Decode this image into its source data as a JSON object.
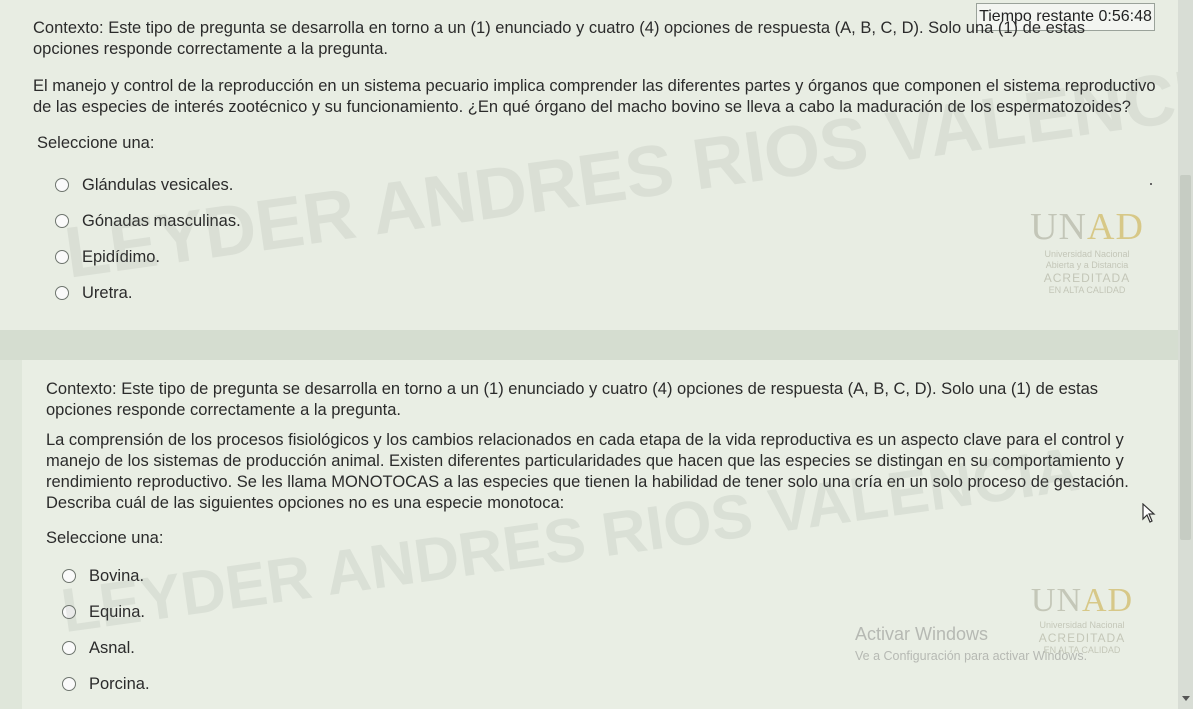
{
  "timer": {
    "label": "Tiempo restante",
    "value": "0:56:48"
  },
  "question1": {
    "context": "Contexto: Este tipo de pregunta se desarrolla en torno a un (1) enunciado y cuatro (4) opciones de respuesta (A, B, C, D). Solo una (1) de estas opciones responde correctamente a la pregunta.",
    "stem": "El manejo y control de la reproducción en un sistema pecuario implica comprender las diferentes partes y órganos que componen el sistema reproductivo de las especies de interés zootécnico y su funcionamiento. ¿En qué órgano del macho bovino se lleva a cabo la maduración de los espermatozoides?",
    "prompt": "Seleccione una:",
    "options": [
      "Glándulas vesicales.",
      "Gónadas masculinas.",
      "Epidídimo.",
      "Uretra."
    ]
  },
  "question2": {
    "context": "Contexto: Este tipo de pregunta se desarrolla en torno a un (1) enunciado y cuatro (4) opciones de respuesta (A, B, C, D). Solo una (1) de estas opciones responde correctamente a la pregunta.",
    "stem": "La comprensión de los procesos fisiológicos y los cambios relacionados en cada etapa de la vida reproductiva es un aspecto clave para el control y manejo de los sistemas de producción animal. Existen diferentes particularidades que hacen que las especies se distingan en su comportamiento y rendimiento reproductivo. Se les llama MONOTOCAS a las especies que tienen la habilidad de tener solo una cría en un solo proceso de gestación. Describa cuál de las siguientes opciones no es una especie monotoca:",
    "prompt": "Seleccione una:",
    "options": [
      "Bovina.",
      "Equina.",
      "Asnal.",
      "Porcina."
    ]
  },
  "watermark": {
    "text": "LEYDER ANDRES RIOS VALENCIA"
  },
  "logo": {
    "mark_u": "U",
    "mark_n": "N",
    "mark_ad": "AD",
    "subtitle_1": "Universidad Nacional",
    "subtitle_2": "Abierta y a Distancia",
    "accreditation": "ACREDITADA",
    "accreditation_sub": "EN ALTA CALIDAD"
  },
  "windows_activation": {
    "title": "Activar Windows",
    "subtitle": "Ve a Configuración para activar Windows."
  },
  "colors": {
    "background": "#e8ede3",
    "timer_border": "#9aa29a"
  }
}
